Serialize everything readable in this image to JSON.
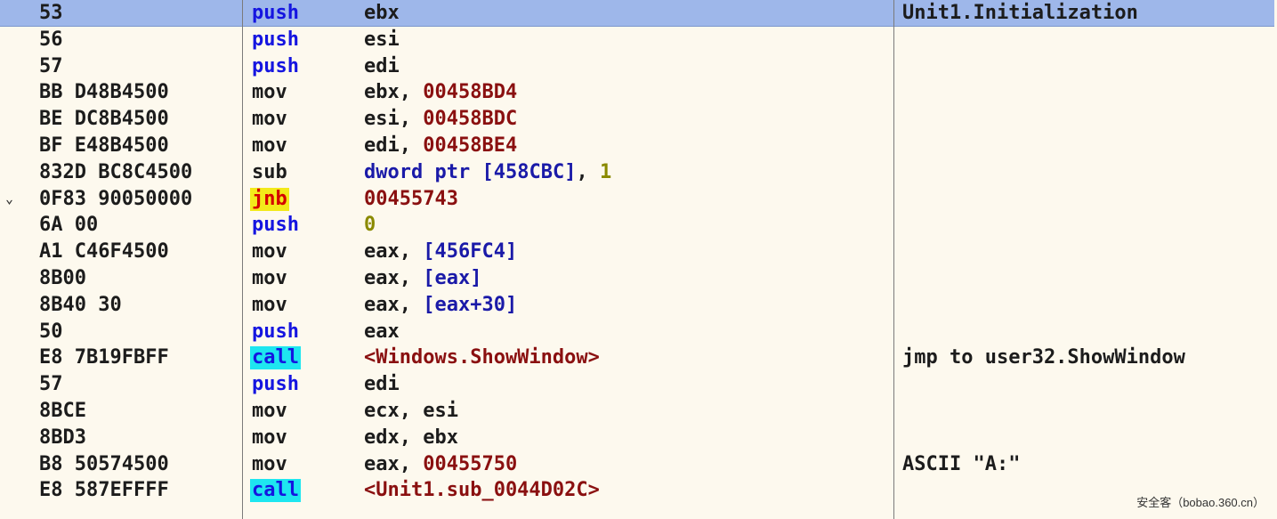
{
  "rows": [
    {
      "hex": "53",
      "mnemonic": "push",
      "ops": "ebx",
      "comment": "Unit1.Initialization",
      "selected": true
    },
    {
      "hex": "56",
      "mnemonic": "push",
      "ops": "esi",
      "comment": ""
    },
    {
      "hex": "57",
      "mnemonic": "push",
      "ops": "edi",
      "comment": ""
    },
    {
      "hex": "BB D48B4500",
      "mnemonic": "mov",
      "ops": "ebx, 00458BD4",
      "comment": ""
    },
    {
      "hex": "BE DC8B4500",
      "mnemonic": "mov",
      "ops": "esi, 00458BDC",
      "comment": ""
    },
    {
      "hex": "BF E48B4500",
      "mnemonic": "mov",
      "ops": "edi, 00458BE4",
      "comment": ""
    },
    {
      "hex": "832D BC8C4500",
      "mnemonic": "sub",
      "ops": "dword ptr [458CBC], 1",
      "comment": ""
    },
    {
      "hex": "0F83 90050000",
      "mnemonic": "jnb",
      "ops": "00455743",
      "comment": "",
      "jump_marker": "⌄"
    },
    {
      "hex": "6A 00",
      "mnemonic": "push",
      "ops": "0",
      "comment": ""
    },
    {
      "hex": "A1 C46F4500",
      "mnemonic": "mov",
      "ops": "eax, [456FC4]",
      "comment": ""
    },
    {
      "hex": "8B00",
      "mnemonic": "mov",
      "ops": "eax, [eax]",
      "comment": ""
    },
    {
      "hex": "8B40 30",
      "mnemonic": "mov",
      "ops": "eax, [eax+30]",
      "comment": ""
    },
    {
      "hex": "50",
      "mnemonic": "push",
      "ops": "eax",
      "comment": ""
    },
    {
      "hex": "E8 7B19FBFF",
      "mnemonic": "call",
      "ops": "<Windows.ShowWindow>",
      "comment": "jmp to user32.ShowWindow"
    },
    {
      "hex": "57",
      "mnemonic": "push",
      "ops": "edi",
      "comment": ""
    },
    {
      "hex": "8BCE",
      "mnemonic": "mov",
      "ops": "ecx, esi",
      "comment": ""
    },
    {
      "hex": "8BD3",
      "mnemonic": "mov",
      "ops": "edx, ebx",
      "comment": ""
    },
    {
      "hex": "B8 50574500",
      "mnemonic": "mov",
      "ops": "eax, 00455750",
      "comment": "ASCII \"A:\""
    },
    {
      "hex": "E8 587EFFFF",
      "mnemonic": "call",
      "ops": "<Unit1.sub_0044D02C>",
      "comment": ""
    }
  ],
  "watermark": "安全客（bobao.360.cn）",
  "colors": {
    "background": "#fdf9ee",
    "selection": "#9eb7ea",
    "push_call": "#1515e0",
    "call_highlight": "#1ee6f0",
    "jump_highlight": "#f3ea1a",
    "jump_text": "#d40000",
    "address": "#8a1010",
    "memory": "#1a1aa8",
    "immediate": "#8a8a00"
  }
}
